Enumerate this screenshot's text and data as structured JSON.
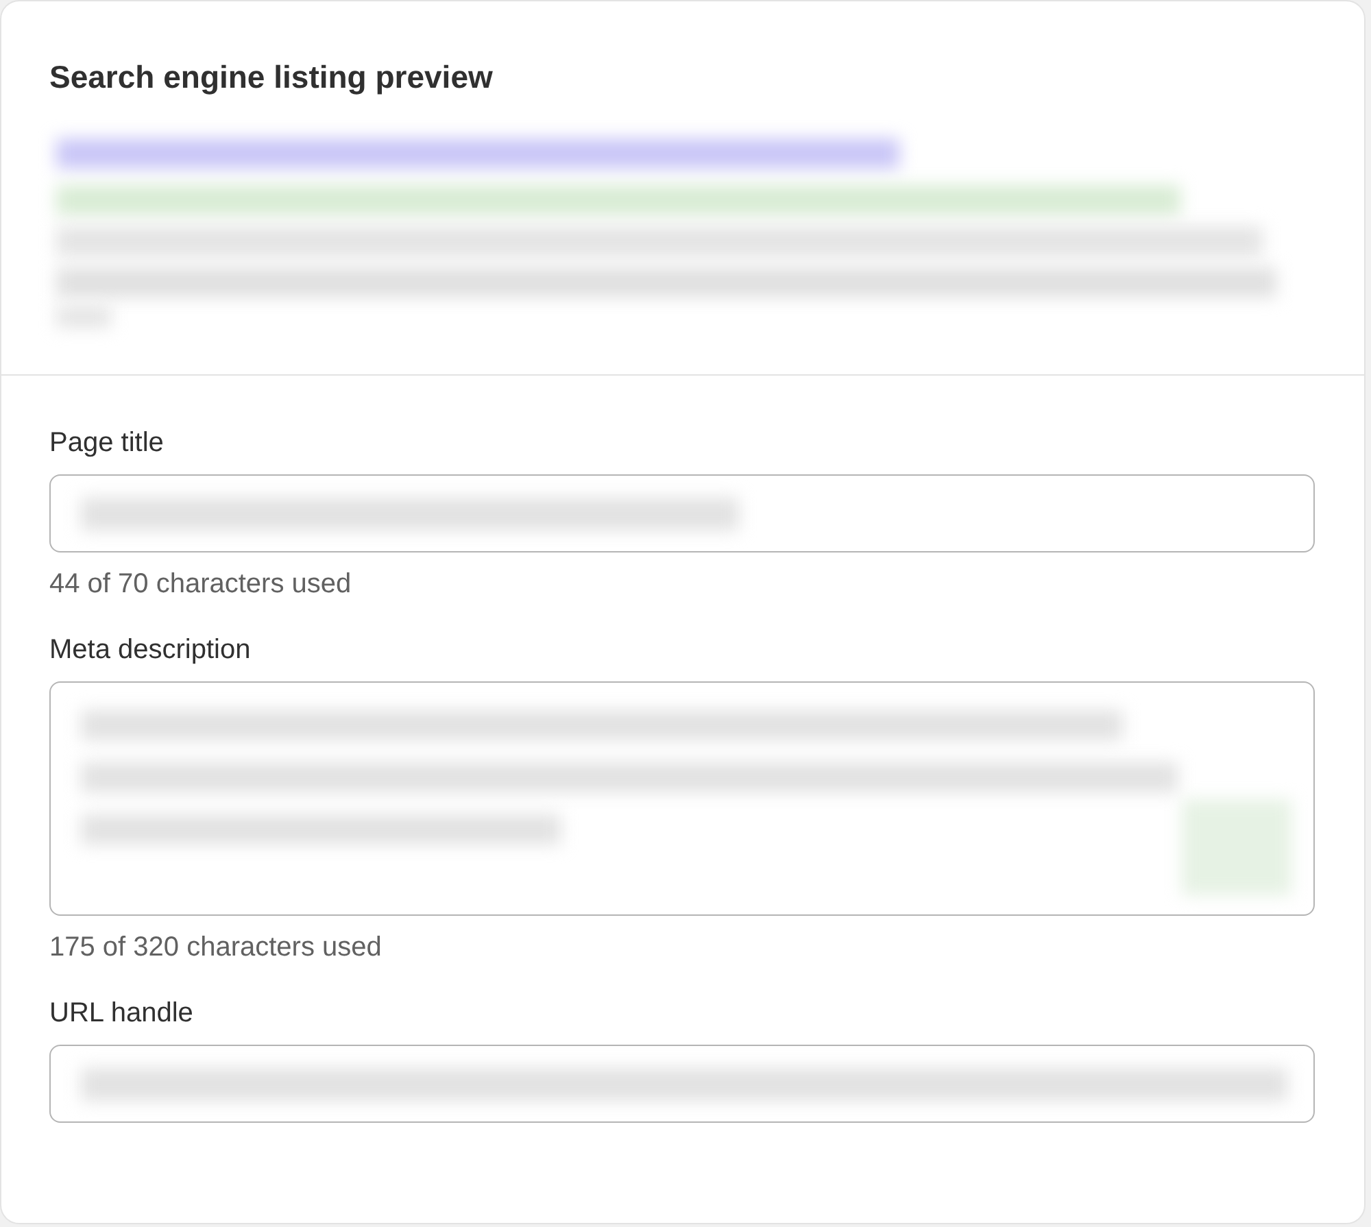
{
  "card": {
    "title": "Search engine listing preview"
  },
  "fields": [
    {
      "kind": "input",
      "label": "Page title",
      "helper": "44 of 70 characters used"
    },
    {
      "kind": "textarea",
      "label": "Meta description",
      "helper": "175 of 320 characters used"
    },
    {
      "kind": "input",
      "label": "URL handle"
    }
  ]
}
